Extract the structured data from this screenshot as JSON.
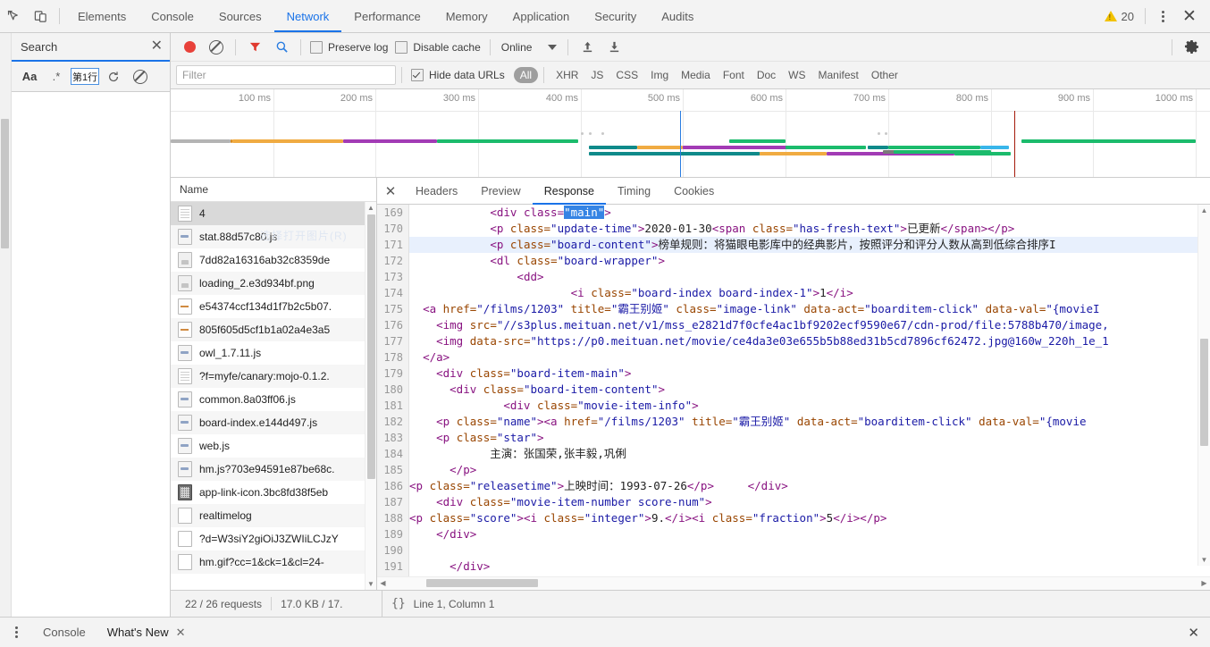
{
  "window": {
    "warning_count": "20",
    "menu_icon": "kebab-menu-icon",
    "close_icon": "close-icon"
  },
  "topbar": {
    "inspect_icon": "inspect-element-icon",
    "device_icon": "device-toolbar-icon",
    "tabs": [
      {
        "label": "Elements",
        "active": false
      },
      {
        "label": "Console",
        "active": false
      },
      {
        "label": "Sources",
        "active": false
      },
      {
        "label": "Network",
        "active": true
      },
      {
        "label": "Performance",
        "active": false
      },
      {
        "label": "Memory",
        "active": false
      },
      {
        "label": "Application",
        "active": false
      },
      {
        "label": "Security",
        "active": false
      },
      {
        "label": "Audits",
        "active": false
      }
    ]
  },
  "search_pane": {
    "title": "Search",
    "close_icon": "close-icon",
    "tools": {
      "match_case": "Aa",
      "regex": ".*",
      "line_input_value": "第1行",
      "refresh_icon": "refresh-icon",
      "clear_icon": "clear-icon"
    }
  },
  "network_toolbar": {
    "record_icon": "record-button-icon",
    "clear_icon": "clear-network-log-icon",
    "filter_icon": "filter-funnel-icon",
    "search_icon": "search-icon",
    "preserve_log": {
      "label": "Preserve log",
      "checked": false
    },
    "disable_cache": {
      "label": "Disable cache",
      "checked": false
    },
    "throttling": {
      "value": "Online",
      "caret": "chevron-down-icon"
    },
    "import_icon": "import-har-icon",
    "export_icon": "export-har-icon",
    "settings_icon": "gear-icon"
  },
  "filter_bar": {
    "filter_placeholder": "Filter",
    "hide_data_urls": {
      "label": "Hide data URLs",
      "checked": true
    },
    "types": [
      {
        "label": "All",
        "active": true
      },
      {
        "label": "XHR",
        "active": false
      },
      {
        "label": "JS",
        "active": false
      },
      {
        "label": "CSS",
        "active": false
      },
      {
        "label": "Img",
        "active": false
      },
      {
        "label": "Media",
        "active": false
      },
      {
        "label": "Font",
        "active": false
      },
      {
        "label": "Doc",
        "active": false
      },
      {
        "label": "WS",
        "active": false
      },
      {
        "label": "Manifest",
        "active": false
      },
      {
        "label": "Other",
        "active": false
      }
    ]
  },
  "overview": {
    "ticks": [
      "100 ms",
      "200 ms",
      "300 ms",
      "400 ms",
      "500 ms",
      "600 ms",
      "700 ms",
      "800 ms",
      "900 ms",
      "1000 ms"
    ],
    "dom_content_loaded_color": "#2a7de1",
    "load_event_color": "#a51b0b",
    "colors": {
      "queueing": "#b4b4b4",
      "stalled": "#f0ab42",
      "waiting": "#a23bb5",
      "download": "#1bbb6c",
      "connect": "#0f8a8a",
      "ssl": "#62cfcf"
    }
  },
  "request_list": {
    "header": "Name",
    "ghost_text": "选择打开图片(R)",
    "rows": [
      {
        "name": "4",
        "icon": "document-icon",
        "selected": true
      },
      {
        "name": "stat.88d57c80.js",
        "icon": "script-icon",
        "selected": false
      },
      {
        "name": "7dd82a16316ab32c8359de",
        "icon": "image-icon",
        "selected": false
      },
      {
        "name": "loading_2.e3d934bf.png",
        "icon": "image-icon",
        "selected": false
      },
      {
        "name": "e54374ccf134d1f7b2c5b07.",
        "icon": "dash-icon",
        "selected": false
      },
      {
        "name": "805f605d5cf1b1a02a4e3a5",
        "icon": "dash-icon",
        "selected": false
      },
      {
        "name": "owl_1.7.11.js",
        "icon": "script-icon",
        "selected": false
      },
      {
        "name": "?f=myfe/canary:mojo-0.1.2.",
        "icon": "document-icon",
        "selected": false
      },
      {
        "name": "common.8a03ff06.js",
        "icon": "script-icon",
        "selected": false
      },
      {
        "name": "board-index.e144d497.js",
        "icon": "script-icon",
        "selected": false
      },
      {
        "name": "web.js",
        "icon": "script-icon",
        "selected": false
      },
      {
        "name": "hm.js?703e94591e87be68c.",
        "icon": "script-icon",
        "selected": false
      },
      {
        "name": "app-link-icon.3bc8fd38f5eb",
        "icon": "image-dark-icon",
        "selected": false
      },
      {
        "name": "realtimelog",
        "icon": "plain-icon",
        "selected": false
      },
      {
        "name": "?d=W3siY2giOiJ3ZWIiLCJzY",
        "icon": "plain-icon",
        "selected": false
      },
      {
        "name": "hm.gif?cc=1&ck=1&cl=24-",
        "icon": "plain-icon",
        "selected": false
      }
    ]
  },
  "detail": {
    "close_icon": "close-icon",
    "tabs": [
      {
        "label": "Headers",
        "active": false
      },
      {
        "label": "Preview",
        "active": false
      },
      {
        "label": "Response",
        "active": true
      },
      {
        "label": "Timing",
        "active": false
      },
      {
        "label": "Cookies",
        "active": false
      }
    ],
    "first_line_number": 169,
    "code_lines": [
      [
        {
          "t": "txt",
          "s": "            "
        },
        {
          "t": "tag",
          "s": "<div class="
        },
        {
          "t": "sel",
          "s": "\"main\""
        },
        {
          "t": "tag",
          "s": ">"
        }
      ],
      [
        {
          "t": "txt",
          "s": "            "
        },
        {
          "t": "tag",
          "s": "<p "
        },
        {
          "t": "attr",
          "s": "class="
        },
        {
          "t": "val",
          "s": "\"update-time\""
        },
        {
          "t": "tag",
          "s": ">"
        },
        {
          "t": "txt",
          "s": "2020-01-30"
        },
        {
          "t": "tag",
          "s": "<span "
        },
        {
          "t": "attr",
          "s": "class="
        },
        {
          "t": "val",
          "s": "\"has-fresh-text\""
        },
        {
          "t": "tag",
          "s": ">"
        },
        {
          "t": "txt",
          "s": "已更新"
        },
        {
          "t": "tag",
          "s": "</span></p>"
        }
      ],
      [
        {
          "t": "txt",
          "s": "            "
        },
        {
          "t": "tag",
          "s": "<p "
        },
        {
          "t": "attr",
          "s": "class="
        },
        {
          "t": "val",
          "s": "\"board-content\""
        },
        {
          "t": "tag",
          "s": ">"
        },
        {
          "t": "txt",
          "s": "榜单规则：将猫眼电影库中的经典影片，按照评分和评分人数从高到低综合排序І"
        }
      ],
      [
        {
          "t": "txt",
          "s": "            "
        },
        {
          "t": "tag",
          "s": "<dl "
        },
        {
          "t": "attr",
          "s": "class="
        },
        {
          "t": "val",
          "s": "\"board-wrapper\""
        },
        {
          "t": "tag",
          "s": ">"
        }
      ],
      [
        {
          "t": "txt",
          "s": "                "
        },
        {
          "t": "tag",
          "s": "<dd>"
        }
      ],
      [
        {
          "t": "txt",
          "s": "                        "
        },
        {
          "t": "tag",
          "s": "<i "
        },
        {
          "t": "attr",
          "s": "class="
        },
        {
          "t": "val",
          "s": "\"board-index board-index-1\""
        },
        {
          "t": "tag",
          "s": ">"
        },
        {
          "t": "txt",
          "s": "1"
        },
        {
          "t": "tag",
          "s": "</i>"
        }
      ],
      [
        {
          "t": "txt",
          "s": "  "
        },
        {
          "t": "tag",
          "s": "<a "
        },
        {
          "t": "attr",
          "s": "href="
        },
        {
          "t": "val",
          "s": "\"/films/1203\""
        },
        {
          "t": "txt",
          "s": " "
        },
        {
          "t": "attr",
          "s": "title="
        },
        {
          "t": "val",
          "s": "\"霸王别姬\""
        },
        {
          "t": "txt",
          "s": " "
        },
        {
          "t": "attr",
          "s": "class="
        },
        {
          "t": "val",
          "s": "\"image-link\""
        },
        {
          "t": "txt",
          "s": " "
        },
        {
          "t": "attr",
          "s": "data-act="
        },
        {
          "t": "val",
          "s": "\"boarditem-click\""
        },
        {
          "t": "txt",
          "s": " "
        },
        {
          "t": "attr",
          "s": "data-val="
        },
        {
          "t": "val",
          "s": "\"{movieI"
        }
      ],
      [
        {
          "t": "txt",
          "s": "    "
        },
        {
          "t": "tag",
          "s": "<img "
        },
        {
          "t": "attr",
          "s": "src="
        },
        {
          "t": "val",
          "s": "\"//s3plus.meituan.net/v1/mss_e2821d7f0cfe4ac1bf9202ecf9590e67/cdn-prod/file:5788b470/image,"
        }
      ],
      [
        {
          "t": "txt",
          "s": "    "
        },
        {
          "t": "tag",
          "s": "<img "
        },
        {
          "t": "attr",
          "s": "data-src="
        },
        {
          "t": "val",
          "s": "\"https://p0.meituan.net/movie/ce4da3e03e655b5b88ed31b5cd7896cf62472.jpg@160w_220h_1e_1"
        }
      ],
      [
        {
          "t": "txt",
          "s": "  "
        },
        {
          "t": "tag",
          "s": "</a>"
        }
      ],
      [
        {
          "t": "txt",
          "s": "    "
        },
        {
          "t": "tag",
          "s": "<div "
        },
        {
          "t": "attr",
          "s": "class="
        },
        {
          "t": "val",
          "s": "\"board-item-main\""
        },
        {
          "t": "tag",
          "s": ">"
        }
      ],
      [
        {
          "t": "txt",
          "s": "      "
        },
        {
          "t": "tag",
          "s": "<div "
        },
        {
          "t": "attr",
          "s": "class="
        },
        {
          "t": "val",
          "s": "\"board-item-content\""
        },
        {
          "t": "tag",
          "s": ">"
        }
      ],
      [
        {
          "t": "txt",
          "s": "              "
        },
        {
          "t": "tag",
          "s": "<div "
        },
        {
          "t": "attr",
          "s": "class="
        },
        {
          "t": "val",
          "s": "\"movie-item-info\""
        },
        {
          "t": "tag",
          "s": ">"
        }
      ],
      [
        {
          "t": "txt",
          "s": "    "
        },
        {
          "t": "tag",
          "s": "<p "
        },
        {
          "t": "attr",
          "s": "class="
        },
        {
          "t": "val",
          "s": "\"name\""
        },
        {
          "t": "tag",
          "s": "><a "
        },
        {
          "t": "attr",
          "s": "href="
        },
        {
          "t": "val",
          "s": "\"/films/1203\""
        },
        {
          "t": "txt",
          "s": " "
        },
        {
          "t": "attr",
          "s": "title="
        },
        {
          "t": "val",
          "s": "\"霸王别姬\""
        },
        {
          "t": "txt",
          "s": " "
        },
        {
          "t": "attr",
          "s": "data-act="
        },
        {
          "t": "val",
          "s": "\"boarditem-click\""
        },
        {
          "t": "txt",
          "s": " "
        },
        {
          "t": "attr",
          "s": "data-val="
        },
        {
          "t": "val",
          "s": "\"{movie"
        }
      ],
      [
        {
          "t": "txt",
          "s": "    "
        },
        {
          "t": "tag",
          "s": "<p "
        },
        {
          "t": "attr",
          "s": "class="
        },
        {
          "t": "val",
          "s": "\"star\""
        },
        {
          "t": "tag",
          "s": ">"
        }
      ],
      [
        {
          "t": "txt",
          "s": "            主演：张国荣,张丰毅,巩俐"
        }
      ],
      [
        {
          "t": "txt",
          "s": "      "
        },
        {
          "t": "tag",
          "s": "</p>"
        }
      ],
      [
        {
          "t": "tag",
          "s": "<p "
        },
        {
          "t": "attr",
          "s": "class="
        },
        {
          "t": "val",
          "s": "\"releasetime\""
        },
        {
          "t": "tag",
          "s": ">"
        },
        {
          "t": "txt",
          "s": "上映时间：1993-07-26"
        },
        {
          "t": "tag",
          "s": "</p>"
        },
        {
          "t": "txt",
          "s": "     "
        },
        {
          "t": "tag",
          "s": "</div>"
        }
      ],
      [
        {
          "t": "txt",
          "s": "    "
        },
        {
          "t": "tag",
          "s": "<div "
        },
        {
          "t": "attr",
          "s": "class="
        },
        {
          "t": "val",
          "s": "\"movie-item-number score-num\""
        },
        {
          "t": "tag",
          "s": ">"
        }
      ],
      [
        {
          "t": "tag",
          "s": "<p "
        },
        {
          "t": "attr",
          "s": "class="
        },
        {
          "t": "val",
          "s": "\"score\""
        },
        {
          "t": "tag",
          "s": "><i "
        },
        {
          "t": "attr",
          "s": "class="
        },
        {
          "t": "val",
          "s": "\"integer\""
        },
        {
          "t": "tag",
          "s": ">"
        },
        {
          "t": "txt",
          "s": "9."
        },
        {
          "t": "tag",
          "s": "</i><i "
        },
        {
          "t": "attr",
          "s": "class="
        },
        {
          "t": "val",
          "s": "\"fraction\""
        },
        {
          "t": "tag",
          "s": ">"
        },
        {
          "t": "txt",
          "s": "5"
        },
        {
          "t": "tag",
          "s": "</i></p>"
        }
      ],
      [
        {
          "t": "txt",
          "s": "    "
        },
        {
          "t": "tag",
          "s": "</div>"
        }
      ],
      [
        {
          "t": "txt",
          "s": ""
        }
      ],
      [
        {
          "t": "txt",
          "s": "      "
        },
        {
          "t": "tag",
          "s": "</div>"
        }
      ],
      [
        {
          "t": "txt",
          "s": ""
        }
      ]
    ]
  },
  "status_bar": {
    "requests": "22 / 26 requests",
    "transferred": "17.0 KB / 17.",
    "format_icon": "pretty-print-icon",
    "cursor_position": "Line 1, Column 1"
  },
  "drawer": {
    "menu_icon": "kebab-menu-icon",
    "tabs": [
      {
        "label": "Console",
        "active": false,
        "closable": false
      },
      {
        "label": "What's New",
        "active": true,
        "closable": true
      }
    ],
    "close_icon": "close-icon"
  }
}
